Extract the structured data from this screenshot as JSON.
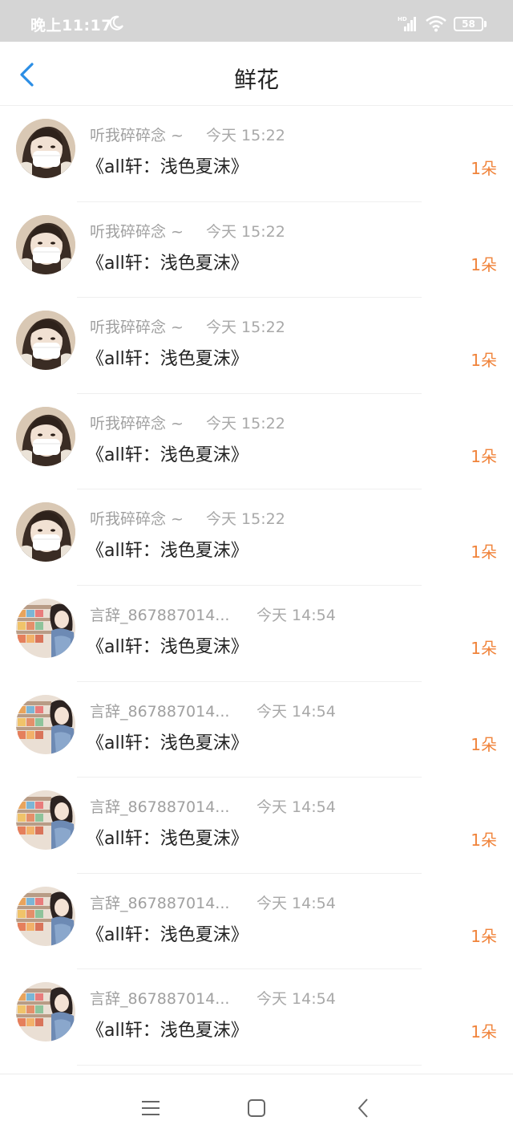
{
  "status_bar": {
    "time": "晚上11:17",
    "battery": "58",
    "icons": [
      "moon-icon",
      "hd-signal-icon",
      "wifi-icon",
      "battery-icon"
    ]
  },
  "header": {
    "title": "鲜花",
    "back_icon": "chevron-left-icon",
    "accent_color": "#2b8ee5"
  },
  "colors": {
    "count": "#f0833a",
    "secondary_text": "#a0a0a0",
    "primary_text": "#222222"
  },
  "items": [
    {
      "sender": "听我碎碎念 ~",
      "time": "今天 15:22",
      "book": "《all轩：浅色夏沫》",
      "count": "1朵",
      "avatar": "masked-girl"
    },
    {
      "sender": "听我碎碎念 ~",
      "time": "今天 15:22",
      "book": "《all轩：浅色夏沫》",
      "count": "1朵",
      "avatar": "masked-girl"
    },
    {
      "sender": "听我碎碎念 ~",
      "time": "今天 15:22",
      "book": "《all轩：浅色夏沫》",
      "count": "1朵",
      "avatar": "masked-girl"
    },
    {
      "sender": "听我碎碎念 ~",
      "time": "今天 15:22",
      "book": "《all轩：浅色夏沫》",
      "count": "1朵",
      "avatar": "masked-girl"
    },
    {
      "sender": "听我碎碎念 ~",
      "time": "今天 15:22",
      "book": "《all轩：浅色夏沫》",
      "count": "1朵",
      "avatar": "masked-girl"
    },
    {
      "sender": "言辞_867887014...",
      "time": "今天 14:54",
      "book": "《all轩：浅色夏沫》",
      "count": "1朵",
      "avatar": "anime-store-girl"
    },
    {
      "sender": "言辞_867887014...",
      "time": "今天 14:54",
      "book": "《all轩：浅色夏沫》",
      "count": "1朵",
      "avatar": "anime-store-girl"
    },
    {
      "sender": "言辞_867887014...",
      "time": "今天 14:54",
      "book": "《all轩：浅色夏沫》",
      "count": "1朵",
      "avatar": "anime-store-girl"
    },
    {
      "sender": "言辞_867887014...",
      "time": "今天 14:54",
      "book": "《all轩：浅色夏沫》",
      "count": "1朵",
      "avatar": "anime-store-girl"
    },
    {
      "sender": "言辞_867887014...",
      "time": "今天 14:54",
      "book": "《all轩：浅色夏沫》",
      "count": "1朵",
      "avatar": "anime-store-girl"
    }
  ],
  "nav_bar": {
    "icons": [
      "menu-icon",
      "home-square-icon",
      "back-triangle-icon"
    ]
  }
}
